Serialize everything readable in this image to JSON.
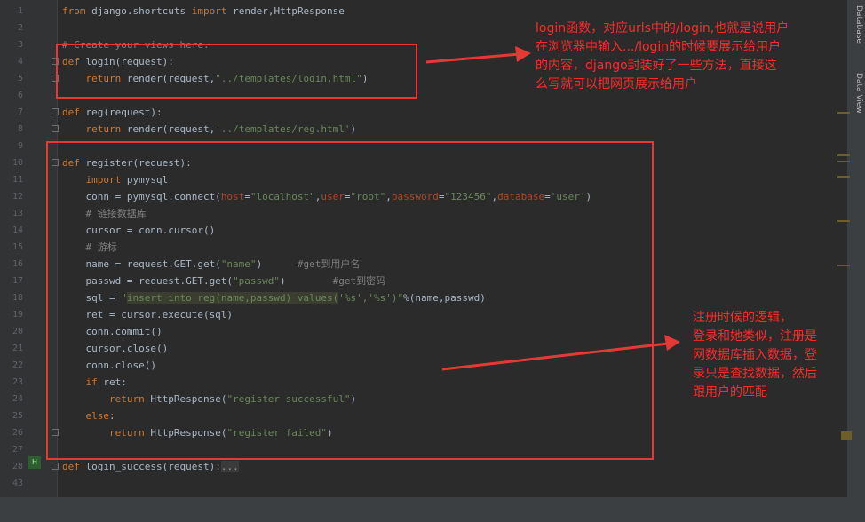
{
  "editor": {
    "lines": [
      {
        "n": "1",
        "html": "<span class='kw'>from</span> django.shortcuts <span class='kw'>import</span> render,HttpResponse"
      },
      {
        "n": "2",
        "html": ""
      },
      {
        "n": "3",
        "html": "<span class='cm'># Create your views here.</span>"
      },
      {
        "n": "4",
        "html": "<span class='kw'>def</span> login(request):"
      },
      {
        "n": "5",
        "html": "    <span class='kw'>return</span> render(request,<span class='str'>\"../templates/login.html\"</span>)"
      },
      {
        "n": "6",
        "html": ""
      },
      {
        "n": "7",
        "html": "<span class='kw'>def</span> reg(request):"
      },
      {
        "n": "8",
        "html": "    <span class='kw'>return</span> render(request,<span class='str'>'../templates/reg.html'</span>)"
      },
      {
        "n": "9",
        "html": ""
      },
      {
        "n": "10",
        "html": "<span class='kw'>def</span> register(request):"
      },
      {
        "n": "11",
        "html": "    <span class='kw'>import</span> pymysql"
      },
      {
        "n": "12",
        "html": "    conn = pymysql.connect(<span class='param'>host</span>=<span class='str'>\"localhost\"</span>,<span class='param'>user</span>=<span class='str'>\"root\"</span>,<span class='param'>password</span>=<span class='str'>\"123456\"</span>,<span class='param'>database</span>=<span class='str'>'user'</span>)"
      },
      {
        "n": "13",
        "html": "    <span class='cm'># 链接数据库</span>"
      },
      {
        "n": "14",
        "html": "    cursor = conn.cursor()"
      },
      {
        "n": "15",
        "html": "    <span class='cm'># 游标</span>"
      },
      {
        "n": "16",
        "html": "    name = request.GET.get(<span class='str'>\"name\"</span>)      <span class='cm'>#get到用户名</span>"
      },
      {
        "n": "17",
        "html": "    passwd = request.GET.get(<span class='str'>\"passwd\"</span>)        <span class='cm'>#get到密码</span>"
      },
      {
        "n": "18",
        "html": "    sql = <span class='str'>\"<span class='hl'>insert into reg(name,passwd) values(</span>'%s','%s')\"</span>%(name,passwd)"
      },
      {
        "n": "19",
        "html": "    ret = cursor.execute(sql)"
      },
      {
        "n": "20",
        "html": "    conn.commit()"
      },
      {
        "n": "21",
        "html": "    cursor.close()"
      },
      {
        "n": "22",
        "html": "    conn.close()"
      },
      {
        "n": "23",
        "html": "    <span class='kw'>if</span> ret:"
      },
      {
        "n": "24",
        "html": "        <span class='kw'>return</span> HttpResponse(<span class='str'>\"register successful\"</span>)"
      },
      {
        "n": "25",
        "html": "    <span class='kw'>else</span>:"
      },
      {
        "n": "26",
        "html": "        <span class='kw'>return</span> HttpResponse(<span class='str'>\"register failed\"</span>)"
      },
      {
        "n": "27",
        "html": ""
      },
      {
        "n": "28",
        "html": "<span class='kw'>def</span> login_success(request):<span style='background:#3b3b3b;color:#999'>...</span>"
      },
      {
        "n": "43",
        "html": ""
      }
    ]
  },
  "side_tabs": {
    "database": "Database",
    "data_view": "Data View"
  },
  "annotations": {
    "login_note_lines": [
      "login函数，对应urls中的/login,也就是说用户",
      "在浏览器中输入.../login的时候要展示给用户",
      "的内容，django封装好了一些方法，直接这",
      "么写就可以把网页展示给用户"
    ],
    "register_note_lines": [
      "注册时候的逻辑，",
      "登录和她类似，注册是",
      "网数据库插入数据，登",
      "录只是查找数据，然后",
      "跟用户的匹配"
    ]
  },
  "colors": {
    "annotation": "#ff2a2a",
    "background": "#2b2b2b",
    "keyword": "#cc7832",
    "string": "#6a8759"
  }
}
